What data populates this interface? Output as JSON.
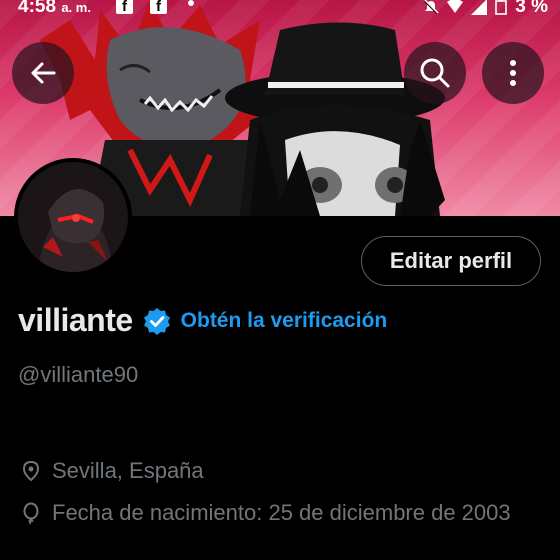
{
  "status_bar": {
    "time": "4:58",
    "time_suffix": "a. m.",
    "battery": "3 %"
  },
  "colors": {
    "background": "#000000",
    "primary_text": "#e7e9ea",
    "secondary_text": "#71767b",
    "link_blue": "#1d9bf0",
    "button_border": "#536471"
  },
  "header": {
    "back_icon": "arrow-left-icon",
    "search_icon": "search-icon",
    "more_icon": "more-vertical-icon"
  },
  "profile": {
    "edit_button": "Editar perfil",
    "display_name": "villiante",
    "verify_link": "Obtén la verificación",
    "handle": "@villiante90",
    "location": "Sevilla, España",
    "birthday": "Fecha de nacimiento: 25 de diciembre de 2003"
  }
}
